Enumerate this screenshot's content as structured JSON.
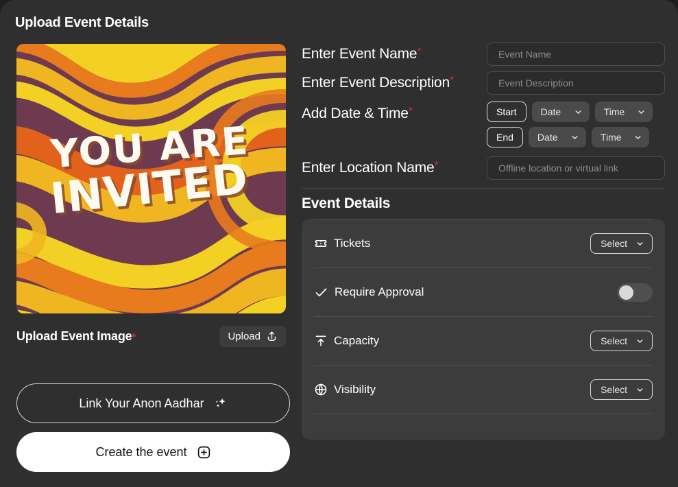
{
  "page": {
    "title": "Upload Event Details",
    "required_marker": "*"
  },
  "left": {
    "event_image": {
      "alt": "You Are Invited retro groovy poster",
      "text_line1": "YOU ARE",
      "text_line2": "INVITED",
      "colors": {
        "maroon": "#6d3a4f",
        "orange": "#e87b1e",
        "deep_orange": "#e2621b",
        "gold": "#f0b622",
        "yellow": "#f2d024",
        "cream": "#fdfaf2"
      }
    },
    "upload_label": "Upload Event Image",
    "upload_button": "Upload",
    "anon_button": "Link Your Anon Aadhar",
    "create_button": "Create the event"
  },
  "form": {
    "event_name": {
      "label": "Enter Event Name",
      "placeholder": "Event Name",
      "value": "",
      "required": true
    },
    "event_description": {
      "label": "Enter Event Description",
      "placeholder": "Event Description",
      "value": "",
      "required": true
    },
    "date_time": {
      "label": "Add Date & Time",
      "required": true,
      "rows": [
        {
          "pill": "Start",
          "date": "Date",
          "time": "Time"
        },
        {
          "pill": "End",
          "date": "Date",
          "time": "Time"
        }
      ]
    },
    "location": {
      "label": "Enter Location Name",
      "placeholder": "Offline location or virtual link",
      "value": "",
      "required": true
    }
  },
  "details": {
    "section_title": "Event Details",
    "rows": [
      {
        "icon": "ticket-icon",
        "label": "Tickets",
        "control": "select",
        "value": "Select"
      },
      {
        "icon": "check-icon",
        "label": "Require Approval",
        "control": "toggle",
        "value": "off"
      },
      {
        "icon": "capacity-icon",
        "label": "Capacity",
        "control": "select",
        "value": "Select"
      },
      {
        "icon": "globe-icon",
        "label": "Visibility",
        "control": "select",
        "value": "Select"
      }
    ]
  },
  "theme": {
    "page_bg": "#2f2f2f",
    "card_bg": "#3c3c3c",
    "accent_required": "#e22b28",
    "text_primary": "#ffffff",
    "text_muted": "#8d8d8d"
  }
}
